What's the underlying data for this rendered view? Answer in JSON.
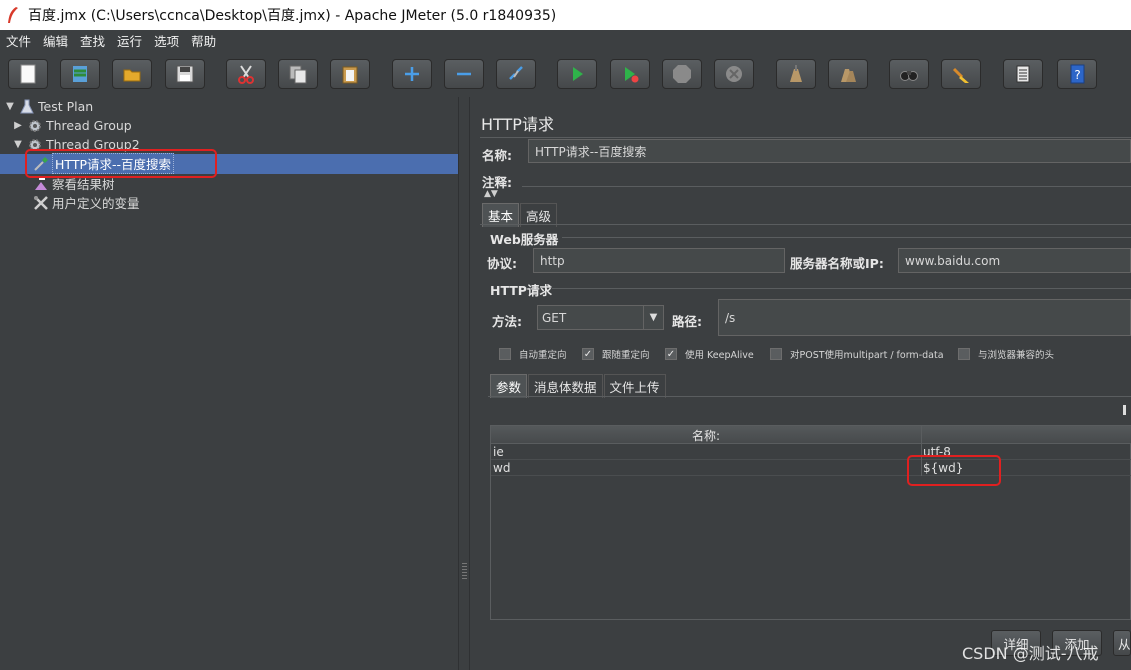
{
  "window": {
    "title": "百度.jmx (C:\\Users\\ccnca\\Desktop\\百度.jmx) - Apache JMeter (5.0 r1840935)"
  },
  "menu": [
    "文件",
    "编辑",
    "查找",
    "运行",
    "选项",
    "帮助"
  ],
  "toolbar_icons": [
    "new-icon",
    "templates-icon",
    "open-icon",
    "save-icon",
    "cut-icon",
    "copy-icon",
    "paste-icon",
    "expand-icon",
    "collapse-icon",
    "toggle-icon",
    "start-icon",
    "start-no-pause-icon",
    "stop-icon",
    "shutdown-icon",
    "clear-icon",
    "clear-all-icon",
    "search-icon",
    "reset-search-icon",
    "function-helper-icon",
    "help-icon"
  ],
  "tree": {
    "items": [
      {
        "label": "Test Plan"
      },
      {
        "label": "Thread Group"
      },
      {
        "label": "Thread Group2"
      },
      {
        "label": "HTTP请求--百度搜索"
      },
      {
        "label": "察看结果树"
      },
      {
        "label": "用户定义的变量"
      }
    ]
  },
  "panel": {
    "title": "HTTP请求",
    "name_label": "名称:",
    "name_value": "HTTP请求--百度搜索",
    "comment_label": "注释:",
    "tabs": [
      "基本",
      "高级"
    ],
    "web_server_title": "Web服务器",
    "protocol_label": "协议:",
    "protocol_value": "http",
    "server_label": "服务器名称或IP:",
    "server_value": "www.baidu.com",
    "http_request_title": "HTTP请求",
    "method_label": "方法:",
    "method_value": "GET",
    "path_label": "路径:",
    "path_value": "/s",
    "checkboxes": [
      {
        "label": "自动重定向",
        "checked": false
      },
      {
        "label": "跟随重定向",
        "checked": true
      },
      {
        "label": "使用 KeepAlive",
        "checked": true
      },
      {
        "label": "对POST使用multipart / form-data",
        "checked": false
      },
      {
        "label": "与浏览器兼容的头",
        "checked": false
      }
    ],
    "sub_tabs": [
      "参数",
      "消息体数据",
      "文件上传"
    ],
    "table": {
      "headers": [
        "名称:",
        ""
      ],
      "rows": [
        {
          "name": "ie",
          "value": "utf-8"
        },
        {
          "name": "wd",
          "value": "${wd}"
        }
      ]
    },
    "buttons": [
      "详细",
      "添加",
      "从"
    ]
  },
  "watermark": "CSDN @测试-八戒"
}
